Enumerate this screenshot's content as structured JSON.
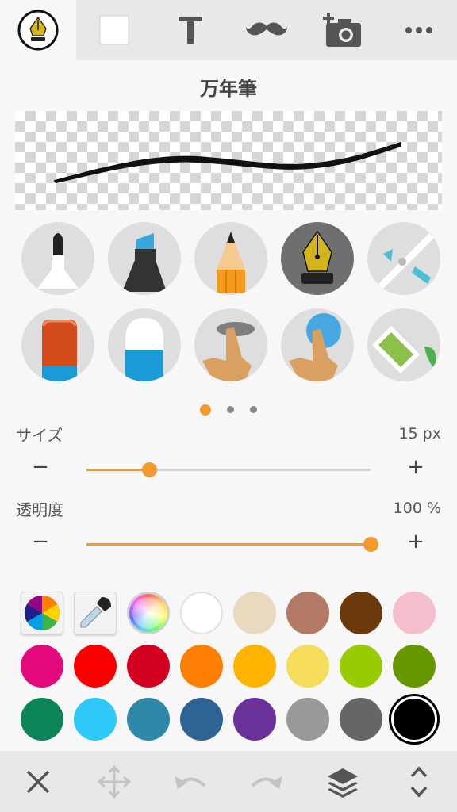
{
  "toolbar": {
    "tabs": [
      "pen-tool",
      "canvas-color",
      "text",
      "stamp",
      "photo",
      "more"
    ]
  },
  "panel": {
    "title": "万年筆"
  },
  "brushes": [
    {
      "name": "marker-brush",
      "selected": false
    },
    {
      "name": "chisel-marker-brush",
      "selected": false
    },
    {
      "name": "pencil-brush",
      "selected": false
    },
    {
      "name": "fountain-pen-brush",
      "selected": true
    },
    {
      "name": "airbrush-brush",
      "selected": false
    },
    {
      "name": "eraser-brush",
      "selected": false
    },
    {
      "name": "soft-eraser-brush",
      "selected": false
    },
    {
      "name": "smudge-finger-brush",
      "selected": false
    },
    {
      "name": "blur-finger-brush",
      "selected": false
    },
    {
      "name": "fill-bucket-brush",
      "selected": false
    }
  ],
  "pager": {
    "count": 3,
    "active": 0
  },
  "size": {
    "label": "サイズ",
    "value": "15 px",
    "fraction": 0.22,
    "minus": "−",
    "plus": "+"
  },
  "opacity": {
    "label": "透明度",
    "value": "100 %",
    "fraction": 1.0,
    "minus": "−",
    "plus": "+"
  },
  "palette": {
    "tools": [
      "color-wheel",
      "eyedropper",
      "rainbow"
    ],
    "colors": [
      "#ffffff",
      "#e8d9bf",
      "#b27a64",
      "#6b3a0c",
      "#f4bfca",
      "#e4087d",
      "#fb0000",
      "#d4001f",
      "#fd7e00",
      "#fdb400",
      "#f5dd5b",
      "#99cc00",
      "#669900",
      "#0b8456",
      "#2fc9f7",
      "#2e88a8",
      "#2e6395",
      "#6b3399",
      "#999999",
      "#666666",
      "#000000"
    ],
    "selected": "#000000"
  },
  "bottom": {
    "buttons": [
      "close",
      "move",
      "undo",
      "redo",
      "layers",
      "expand"
    ]
  }
}
